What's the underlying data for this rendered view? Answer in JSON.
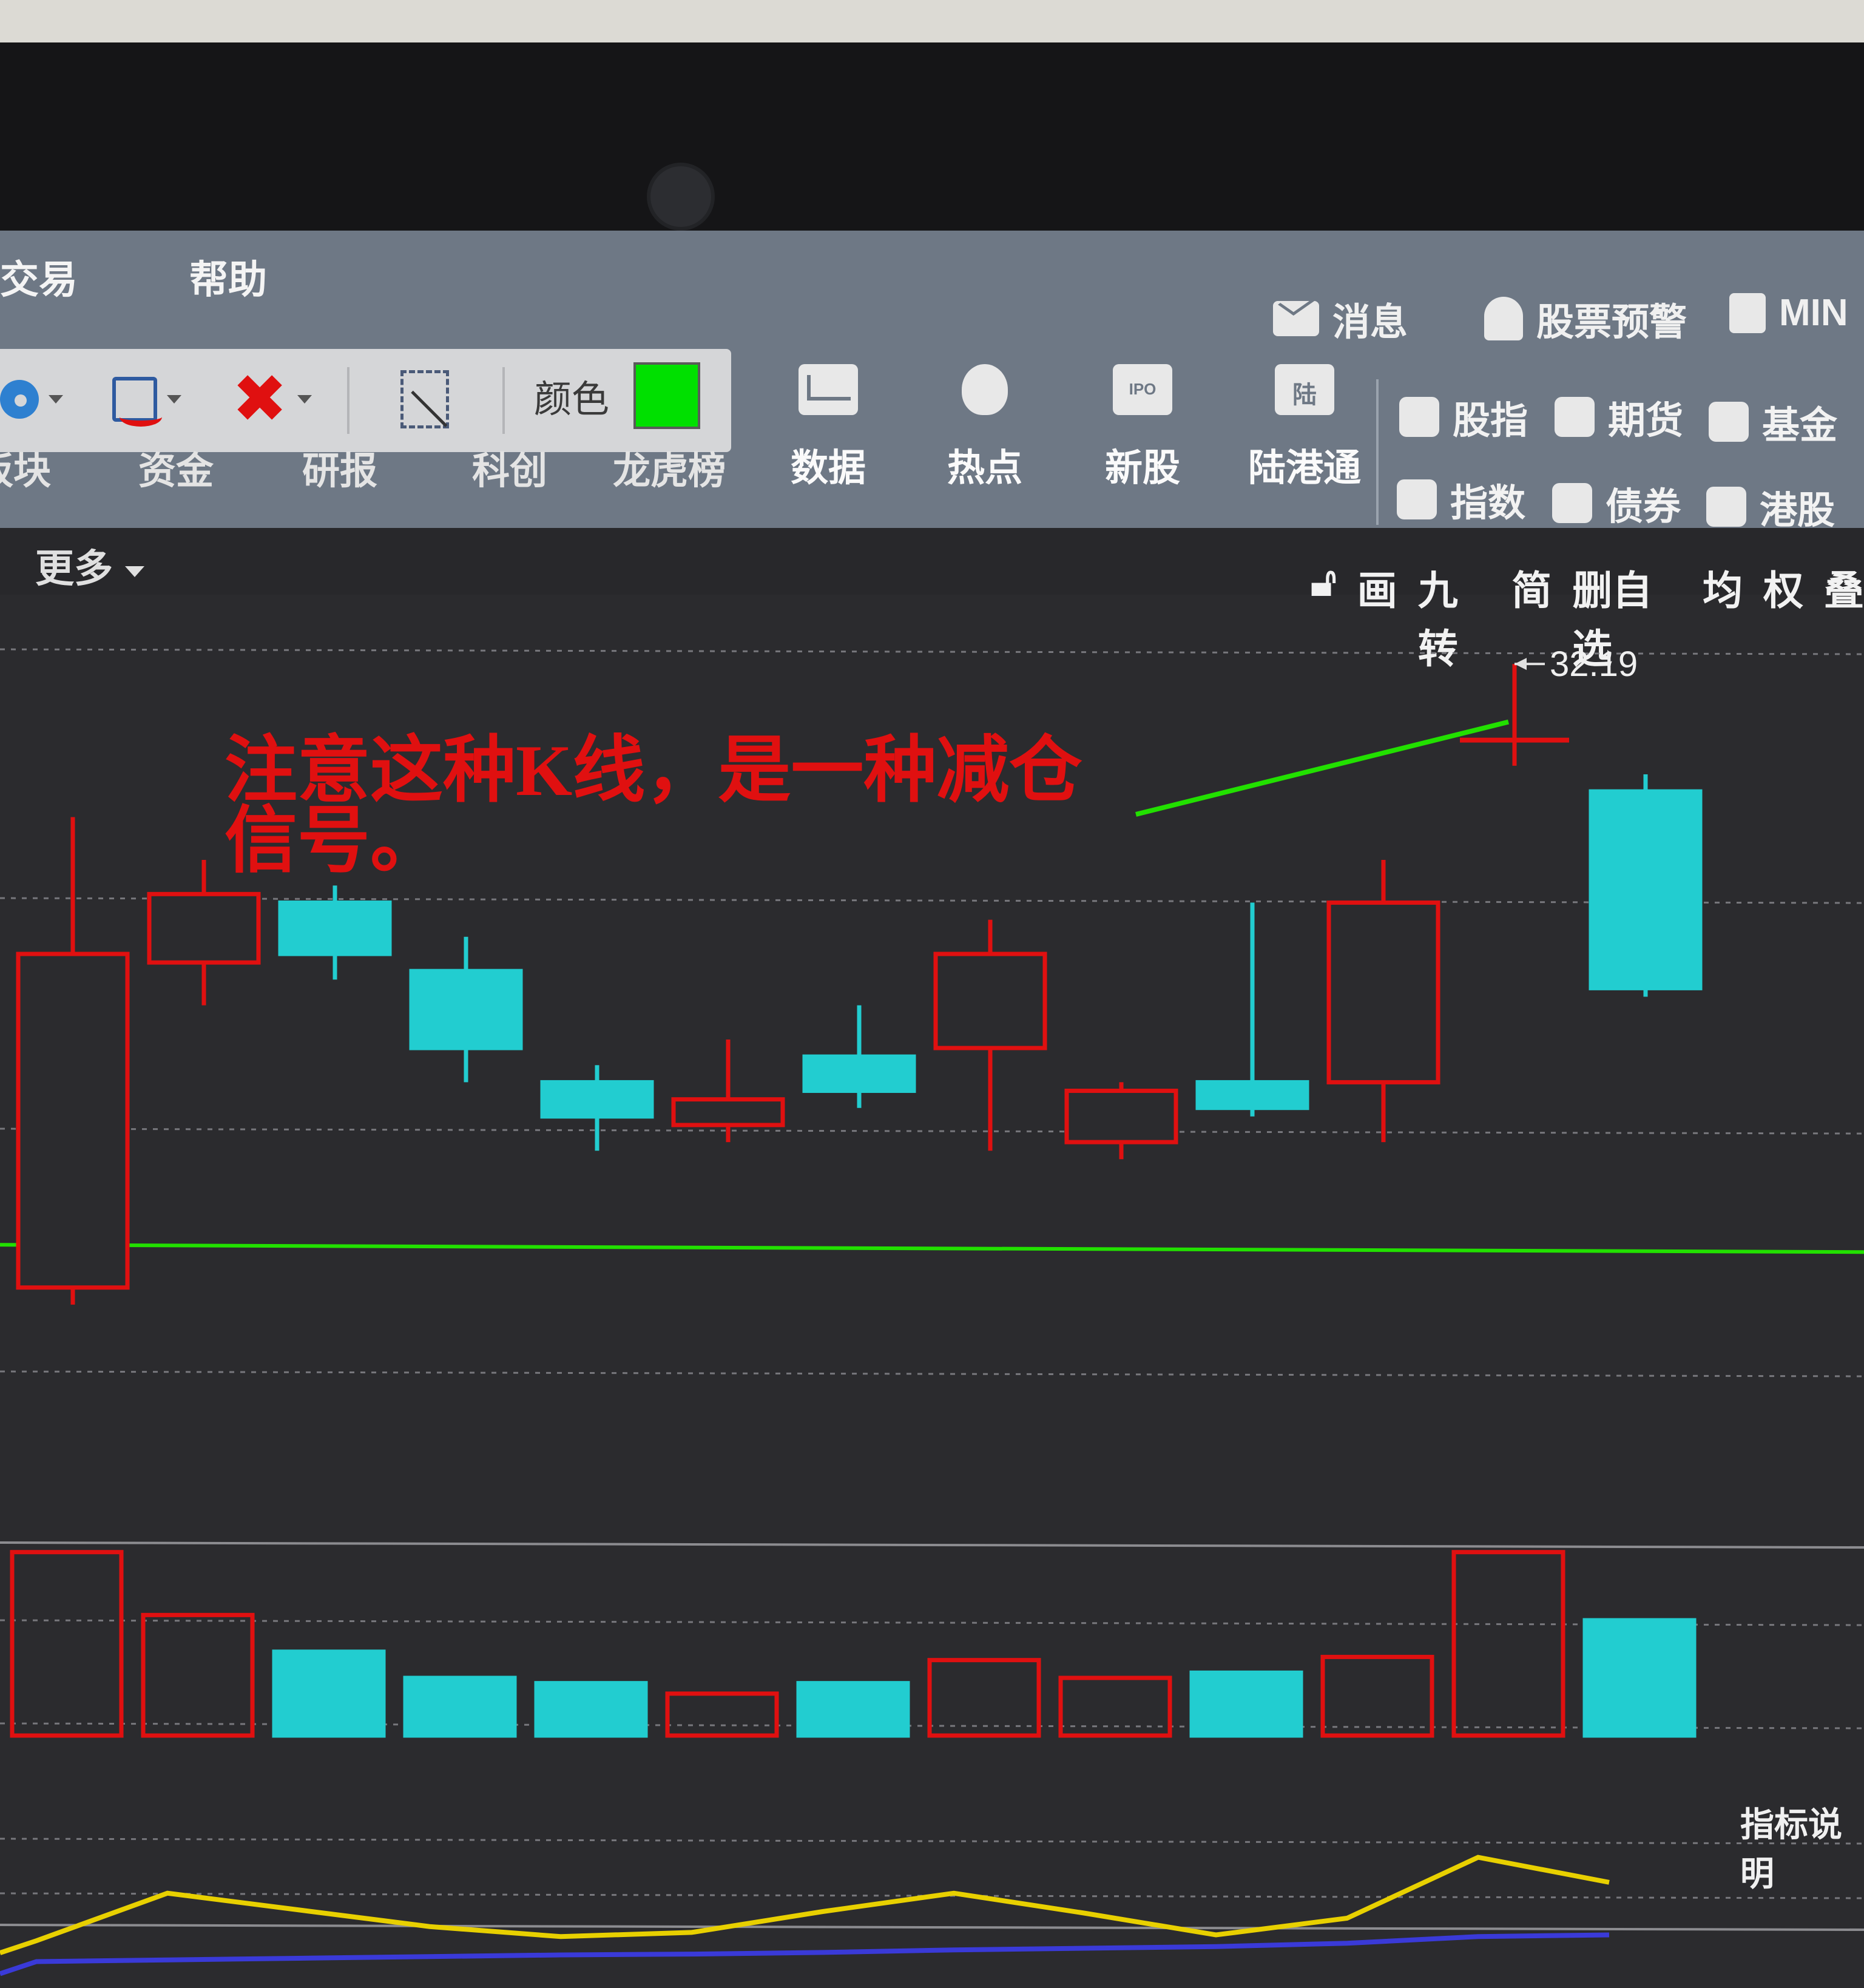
{
  "menu": {
    "trade": "交易",
    "help": "帮助"
  },
  "top_right": {
    "messages": "消息",
    "stock_alert": "股票预警",
    "mini": "MIN"
  },
  "draw_toolbar": {
    "color_label": "颜色",
    "color_value": "#00e000"
  },
  "subnav": [
    "板块",
    "资金",
    "研报",
    "科创",
    "龙虎榜"
  ],
  "big_buttons": [
    {
      "label": "数据",
      "icon": "chart-icon"
    },
    {
      "label": "热点",
      "icon": "fire-icon"
    },
    {
      "label": "新股",
      "icon": "ipo-icon"
    },
    {
      "label": "陆港通",
      "icon": "hk-connect-icon"
    }
  ],
  "markets": {
    "row1": [
      "股指",
      "期货",
      "基金"
    ],
    "row2": [
      "指数",
      "债券",
      "港股"
    ]
  },
  "more_label": "更多",
  "chart_tools": [
    "画",
    "九转",
    "简",
    "删自选",
    "均",
    "权",
    "叠"
  ],
  "annotation": {
    "line1": "注意这种K线，是一种减仓",
    "line2": "信号。",
    "color": "#e01010",
    "arrow_color": "#22e000"
  },
  "indicator_link": "指标说明",
  "chart_data": [
    {
      "type": "candlestick",
      "title": "",
      "up_color": "#e01010",
      "down_color": "#22cdd0",
      "price_marker": {
        "label": "32.19",
        "value": 32.19
      },
      "ylim": [
        22.5,
        33.0
      ],
      "candles": [
        {
          "open": 24.9,
          "close": 28.8,
          "high": 30.4,
          "low": 24.7,
          "dir": "up"
        },
        {
          "open": 28.7,
          "close": 29.5,
          "high": 29.9,
          "low": 28.2,
          "dir": "up"
        },
        {
          "open": 29.4,
          "close": 28.8,
          "high": 29.6,
          "low": 28.5,
          "dir": "down"
        },
        {
          "open": 28.6,
          "close": 27.7,
          "high": 29.0,
          "low": 27.3,
          "dir": "down"
        },
        {
          "open": 27.3,
          "close": 26.9,
          "high": 27.5,
          "low": 26.5,
          "dir": "down"
        },
        {
          "open": 26.8,
          "close": 27.1,
          "high": 27.8,
          "low": 26.6,
          "dir": "up"
        },
        {
          "open": 27.6,
          "close": 27.2,
          "high": 28.2,
          "low": 27.0,
          "dir": "down"
        },
        {
          "open": 27.7,
          "close": 28.8,
          "high": 29.2,
          "low": 26.5,
          "dir": "up"
        },
        {
          "open": 26.6,
          "close": 27.2,
          "high": 27.3,
          "low": 26.4,
          "dir": "up"
        },
        {
          "open": 27.3,
          "close": 27.0,
          "high": 29.4,
          "low": 26.9,
          "dir": "down"
        },
        {
          "open": 27.3,
          "close": 29.4,
          "high": 29.9,
          "low": 26.6,
          "dir": "up"
        },
        {
          "open": 31.3,
          "close": 31.3,
          "high": 32.19,
          "low": 31.0,
          "dir": "doji"
        },
        {
          "open": 30.7,
          "close": 28.4,
          "high": 30.9,
          "low": 28.3,
          "dir": "down"
        }
      ],
      "support_line": {
        "value": 25.4,
        "color": "#22e000"
      }
    },
    {
      "type": "bar",
      "title": "",
      "xlabel": "",
      "ylabel": "",
      "values": [
        1.75,
        1.15,
        0.8,
        0.55,
        0.5,
        0.4,
        0.5,
        0.72,
        0.55,
        0.6,
        0.75,
        1.75,
        1.1
      ],
      "dirs": [
        "up",
        "up",
        "down",
        "down",
        "down",
        "up",
        "down",
        "up",
        "up",
        "down",
        "up",
        "up",
        "down"
      ],
      "ylim": [
        0,
        2.2
      ]
    },
    {
      "type": "line",
      "series": [
        {
          "color": "#e8d000",
          "values": [
            0.25,
            0.82,
            0.62,
            0.42,
            0.3,
            0.35,
            0.6,
            0.82,
            0.58,
            0.32,
            0.52,
            1.25,
            0.95
          ]
        },
        {
          "color": "#3a3ad8",
          "values": [
            0.0,
            0.02,
            0.04,
            0.06,
            0.08,
            0.09,
            0.11,
            0.14,
            0.16,
            0.18,
            0.22,
            0.3,
            0.32
          ]
        }
      ],
      "ylim": [
        -0.2,
        1.4
      ]
    }
  ]
}
